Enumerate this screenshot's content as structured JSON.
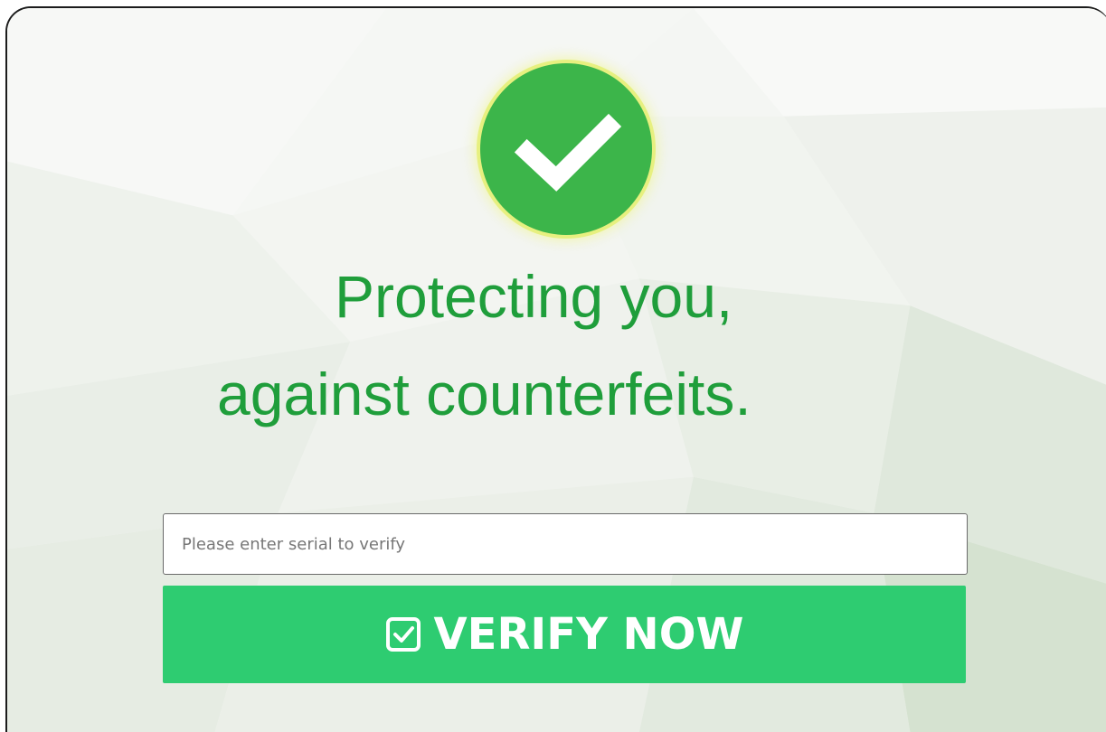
{
  "hero": {
    "badge_icon": "checkmark-icon",
    "headline_line1": "Protecting you,",
    "headline_line2": "against counterfeits."
  },
  "form": {
    "serial_placeholder": "Please enter serial to verify",
    "serial_value": "",
    "verify_label": "VERIFY NOW",
    "verify_icon": "checkbox-check-icon"
  },
  "colors": {
    "accent_green": "#2ecc71",
    "headline_green": "#1f9e3b",
    "badge_green": "#3cb54a"
  }
}
